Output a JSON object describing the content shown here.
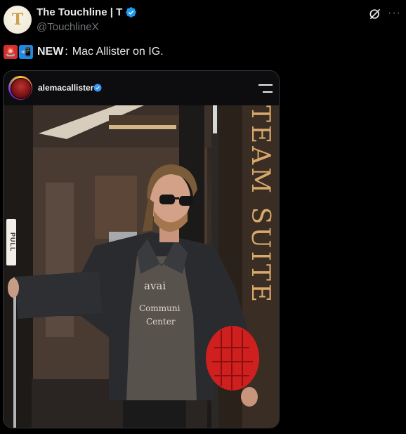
{
  "author": {
    "display_name": "The Touchline | T",
    "handle": "@TouchlineX",
    "avatar_letter": "T",
    "verified": true
  },
  "tweet": {
    "emoji_1": "siren-emoji",
    "emoji_2": "mobile-phone-arrow-emoji",
    "bold_prefix": "NEW",
    "colon": ":",
    "body": " Mac Allister on IG."
  },
  "instagram_post": {
    "username": "alemacallister",
    "verified": true,
    "sign_text": "TEAM SUITE",
    "door_label": "PULL",
    "shirt_text_line1": "avai",
    "shirt_text_line2": "Communi",
    "shirt_text_line3": "Center"
  },
  "icons": {
    "grok": "grok-icon",
    "more": "more-options-icon",
    "menu": "hamburger-menu-icon"
  },
  "colors": {
    "background": "#000000",
    "verified_blue": "#1d9bf0",
    "muted_text": "#71767b",
    "sign_gold": "#d9a86b"
  }
}
